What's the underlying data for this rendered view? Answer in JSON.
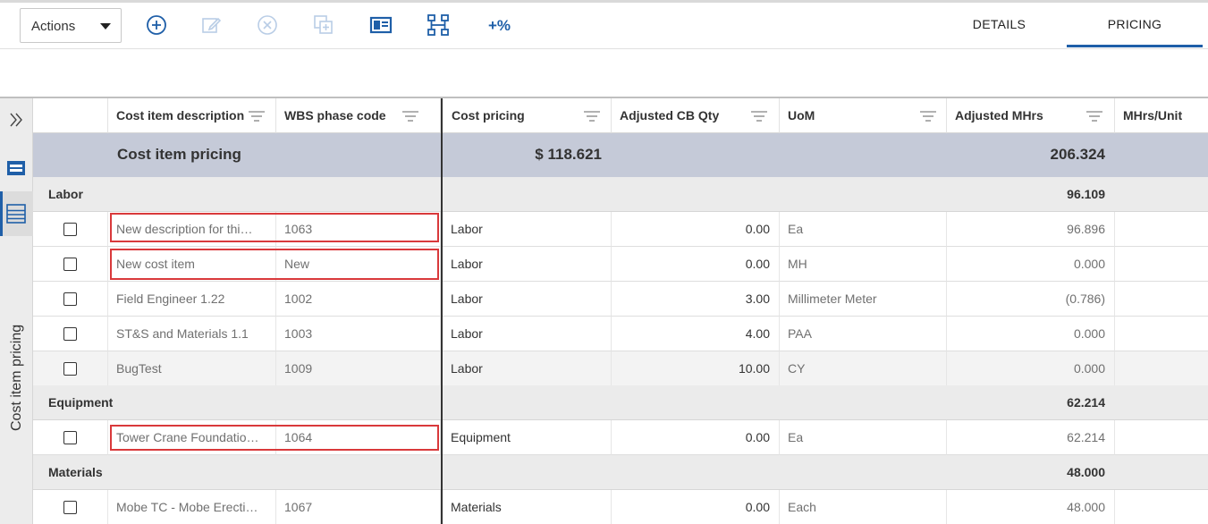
{
  "toolbar": {
    "actions_label": "Actions",
    "icons": [
      "add-icon",
      "edit-icon",
      "delete-icon",
      "copy-icon",
      "layout-icon",
      "hierarchy-icon",
      "percent-icon"
    ],
    "percent_label": "+%",
    "tabs": [
      {
        "label": "DETAILS",
        "active": false
      },
      {
        "label": "PRICING",
        "active": true
      }
    ],
    "accent_color": "#1f5fa8"
  },
  "sidebar": {
    "title": "Cost item pricing",
    "icons": [
      "expand-icon",
      "summary-icon",
      "list-icon"
    ]
  },
  "grid": {
    "columns": [
      "Cost item description",
      "WBS phase code",
      "Cost pricing",
      "Adjusted CB Qty",
      "UoM",
      "Adjusted MHrs",
      "MHrs/Unit"
    ],
    "summary": {
      "label": "Cost item pricing",
      "cost_pricing": "$ 118.621",
      "adjusted_mhrs": "206.324"
    },
    "groups": [
      {
        "name": "Labor",
        "mhrs_total": "96.109",
        "rows": [
          {
            "description": "New description for thi…",
            "wbs": "1063",
            "cost_pricing": "Labor",
            "qty": "0.00",
            "uom": "Ea",
            "mhrs": "96.896",
            "highlighted": true
          },
          {
            "description": "New cost item",
            "wbs": "New",
            "cost_pricing": "Labor",
            "qty": "0.00",
            "uom": "MH",
            "mhrs": "0.000",
            "highlighted": true
          },
          {
            "description": "Field Engineer 1.22",
            "wbs": "1002",
            "cost_pricing": "Labor",
            "qty": "3.00",
            "uom": "Millimeter Meter",
            "mhrs": "(0.786)",
            "highlighted": false
          },
          {
            "description": "ST&S and Materials 1.1",
            "wbs": "1003",
            "cost_pricing": "Labor",
            "qty": "4.00",
            "uom": "PAA",
            "mhrs": "0.000",
            "highlighted": false
          },
          {
            "description": "BugTest",
            "wbs": "1009",
            "cost_pricing": "Labor",
            "qty": "10.00",
            "uom": "CY",
            "mhrs": "0.000",
            "highlighted": false
          }
        ]
      },
      {
        "name": "Equipment",
        "mhrs_total": "62.214",
        "rows": [
          {
            "description": "Tower Crane Foundatio…",
            "wbs": "1064",
            "cost_pricing": "Equipment",
            "qty": "0.00",
            "uom": "Ea",
            "mhrs": "62.214",
            "highlighted": true
          }
        ]
      },
      {
        "name": "Materials",
        "mhrs_total": "48.000",
        "rows": [
          {
            "description": "Mobe TC - Mobe Erecti…",
            "wbs": "1067",
            "cost_pricing": "Materials",
            "qty": "0.00",
            "uom": "Each",
            "mhrs": "48.000",
            "highlighted": false
          }
        ]
      }
    ]
  }
}
